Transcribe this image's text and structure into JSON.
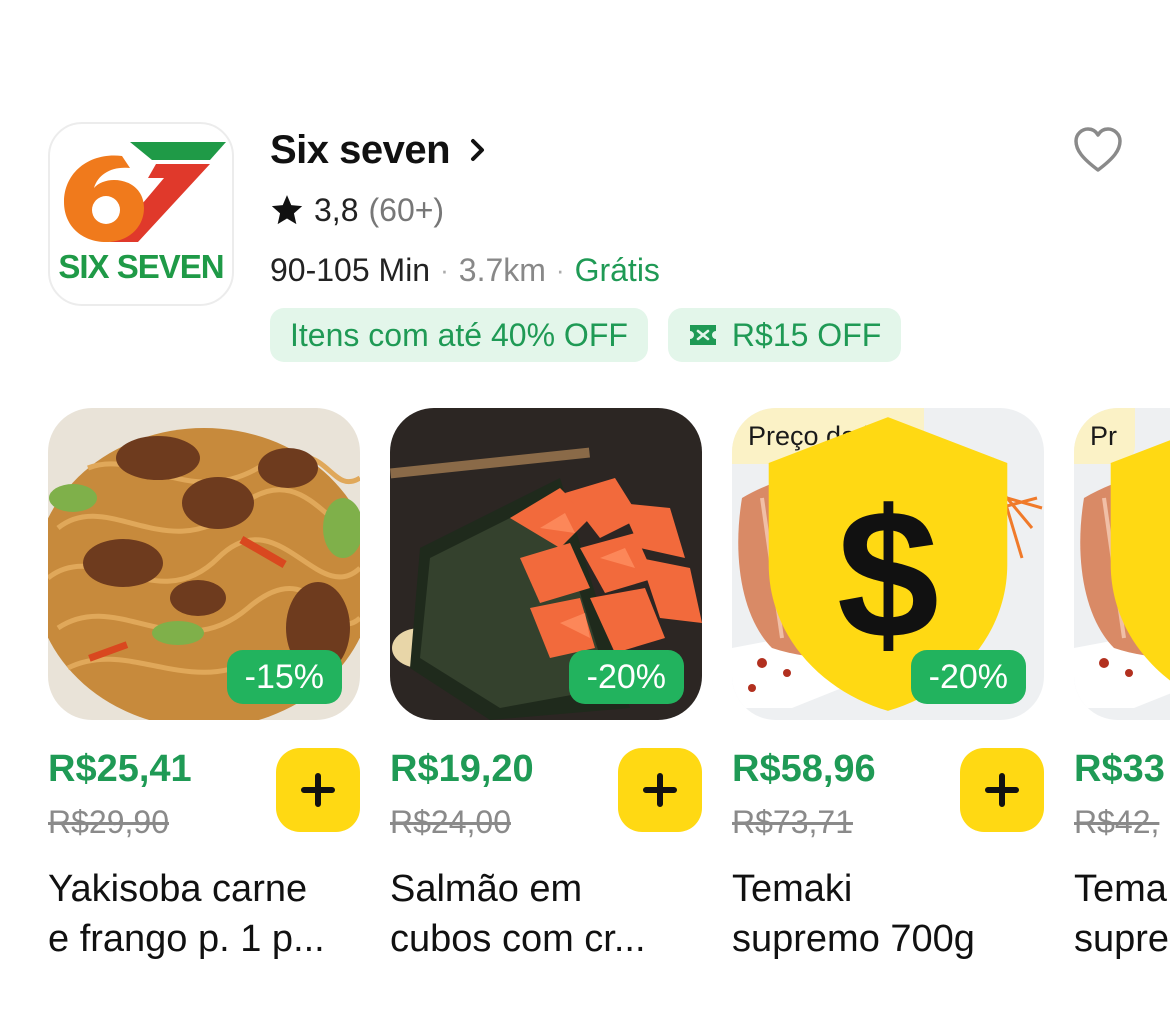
{
  "store": {
    "logo_text": "SIX SEVEN",
    "name": "Six seven",
    "rating": "3,8",
    "rating_count": "(60+)",
    "delivery_time": "90-105 Min",
    "distance": "3.7km",
    "delivery_fee": "Grátis",
    "separator": "·",
    "promos": [
      {
        "label": "Itens com até 40% OFF"
      },
      {
        "label": "R$15 OFF"
      }
    ]
  },
  "products": [
    {
      "name_line1": "Yakisoba carne",
      "name_line2": "e frango p. 1 p...",
      "price": "R$25,41",
      "old_price": "R$29,90",
      "discount": "-15%",
      "badge": ""
    },
    {
      "name_line1": "Salmão em",
      "name_line2": "cubos com cr...",
      "price": "R$19,20",
      "old_price": "R$24,00",
      "discount": "-20%",
      "badge": ""
    },
    {
      "name_line1": "Temaki",
      "name_line2": "supremo 700g",
      "price": "R$58,96",
      "old_price": "R$73,71",
      "discount": "-20%",
      "badge": "Preço da loja"
    },
    {
      "name_line1": "Tema",
      "name_line2": "supre",
      "price": "R$33",
      "old_price": "R$42,",
      "discount": "",
      "badge": "Pr"
    }
  ],
  "colors": {
    "accent_green": "#1f9a55",
    "discount_green": "#22b35e",
    "add_button_yellow": "#ffd913",
    "promo_bg": "#e3f6ea",
    "store_price_badge_bg": "#fbf2c6"
  },
  "icons": [
    "chevron-right-icon",
    "heart-icon",
    "star-icon",
    "ticket-icon",
    "dollar-icon",
    "plus-icon"
  ]
}
